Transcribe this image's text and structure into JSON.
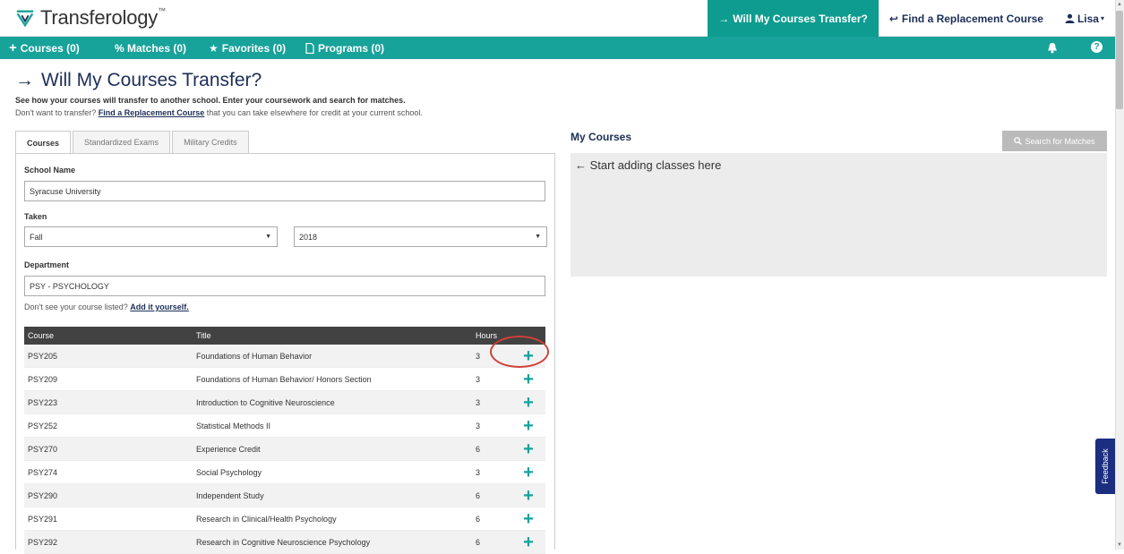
{
  "app": {
    "logo_text": "Transferology",
    "logo_tm": "™"
  },
  "top_nav": {
    "will_transfer": "Will My Courses Transfer?",
    "find_replacement": "Find a Replacement Course",
    "user": "Lisa"
  },
  "green_bar": {
    "courses": "Courses (0)",
    "matches": "% Matches (0)",
    "favorites": "Favorites (0)",
    "programs": "Programs (0)"
  },
  "page": {
    "title": "Will My Courses Transfer?",
    "intro1": "See how your courses will transfer to another school. Enter your coursework and search for matches.",
    "intro2_pre": "Don't want to transfer? ",
    "intro2_link": "Find a Replacement Course",
    "intro2_post": " that you can take elsewhere for credit at your current school."
  },
  "tabs": [
    {
      "label": "Courses",
      "active": true
    },
    {
      "label": "Standardized Exams",
      "active": false
    },
    {
      "label": "Military Credits",
      "active": false
    }
  ],
  "form": {
    "school_label": "School Name",
    "school_value": "Syracuse University",
    "taken_label": "Taken",
    "term_value": "Fall",
    "year_value": "2018",
    "department_label": "Department",
    "department_value": "PSY - PSYCHOLOGY",
    "dont_see": "Don't see your course listed? ",
    "add_it": "Add it yourself."
  },
  "table": {
    "headers": {
      "course": "Course",
      "title": "Title",
      "hours": "Hours"
    },
    "rows": [
      {
        "course": "PSY205",
        "title": "Foundations of Human Behavior",
        "hours": "3"
      },
      {
        "course": "PSY209",
        "title": "Foundations of Human Behavior/ Honors Section",
        "hours": "3"
      },
      {
        "course": "PSY223",
        "title": "Introduction to Cognitive Neuroscience",
        "hours": "3"
      },
      {
        "course": "PSY252",
        "title": "Statistical Methods II",
        "hours": "3"
      },
      {
        "course": "PSY270",
        "title": "Experience Credit",
        "hours": "6"
      },
      {
        "course": "PSY274",
        "title": "Social Psychology",
        "hours": "3"
      },
      {
        "course": "PSY290",
        "title": "Independent Study",
        "hours": "6"
      },
      {
        "course": "PSY291",
        "title": "Research in Clinical/Health Psychology",
        "hours": "6"
      },
      {
        "course": "PSY292",
        "title": "Research in Cognitive Neuroscience Psychology",
        "hours": "6"
      }
    ]
  },
  "my_courses": {
    "title": "My Courses",
    "search_button": "Search for Matches",
    "empty_hint": "Start adding classes here"
  },
  "feedback": "Feedback",
  "colors": {
    "teal": "#17a29a",
    "navy": "#1c2e57",
    "highlight": "#d0403a"
  }
}
